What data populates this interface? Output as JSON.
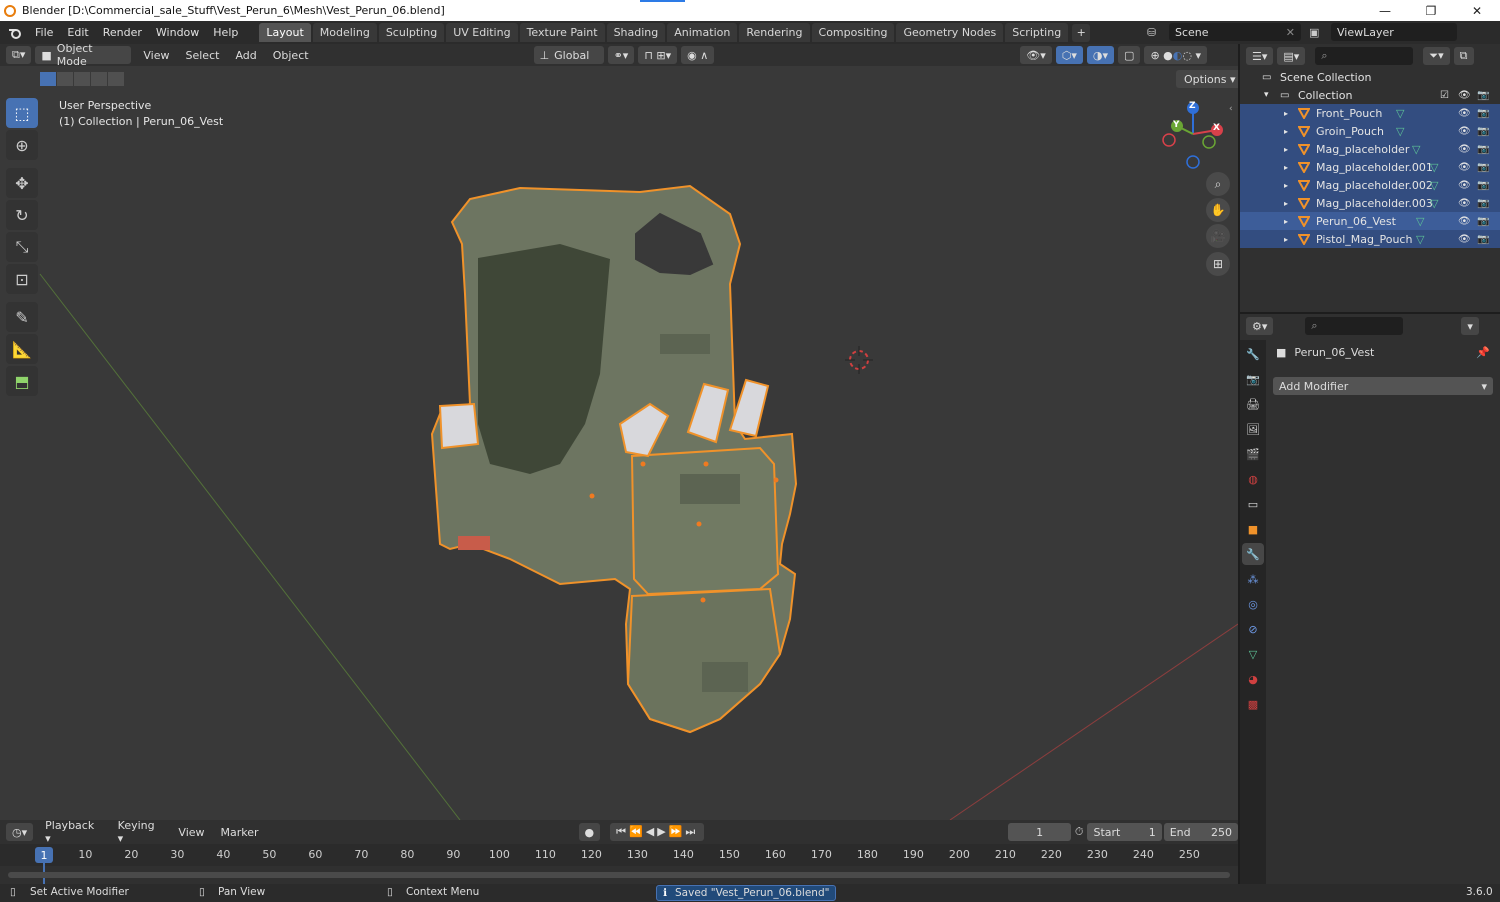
{
  "window": {
    "title": "Blender [D:\\Commercial_sale_Stuff\\Vest_Perun_6\\Mesh\\Vest_Perun_06.blend]",
    "minimize": "—",
    "restore": "❐",
    "close": "✕"
  },
  "topbar": {
    "menus": [
      "File",
      "Edit",
      "Render",
      "Window",
      "Help"
    ],
    "workspaces": [
      "Layout",
      "Modeling",
      "Sculpting",
      "UV Editing",
      "Texture Paint",
      "Shading",
      "Animation",
      "Rendering",
      "Compositing",
      "Geometry Nodes",
      "Scripting"
    ],
    "active_workspace": "Layout",
    "scene": "Scene",
    "view_layer": "ViewLayer"
  },
  "viewport": {
    "mode": "Object Mode",
    "menus": [
      "View",
      "Select",
      "Add",
      "Object"
    ],
    "transform_orientation": "Global",
    "info_line1": "User Perspective",
    "info_line2": "(1) Collection | Perun_06_Vest",
    "options": "Options",
    "gizmo_axes": {
      "z": "Z",
      "y": "Y",
      "x": "X"
    }
  },
  "outliner": {
    "root": "Scene Collection",
    "collection": "Collection",
    "items": [
      {
        "name": "Front_Pouch",
        "selected": true
      },
      {
        "name": "Groin_Pouch",
        "selected": true
      },
      {
        "name": "Mag_placeholder",
        "selected": true
      },
      {
        "name": "Mag_placeholder.001",
        "selected": true
      },
      {
        "name": "Mag_placeholder.002",
        "selected": true
      },
      {
        "name": "Mag_placeholder.003",
        "selected": true
      },
      {
        "name": "Perun_06_Vest",
        "selected": true,
        "active": true
      },
      {
        "name": "Pistol_Mag_Pouch",
        "selected": true
      }
    ]
  },
  "properties": {
    "object_name": "Perun_06_Vest",
    "add_modifier": "Add Modifier"
  },
  "timeline": {
    "menus": [
      "Playback",
      "Keying",
      "View",
      "Marker"
    ],
    "current_frame": "1",
    "start_label": "Start",
    "start": "1",
    "end_label": "End",
    "end": "250",
    "ruler_labels": [
      "1",
      "10",
      "20",
      "30",
      "40",
      "50",
      "60",
      "70",
      "80",
      "90",
      "100",
      "110",
      "120",
      "130",
      "140",
      "150",
      "160",
      "170",
      "180",
      "190",
      "200",
      "210",
      "220",
      "230",
      "240",
      "250"
    ],
    "ruler_frames": [
      1,
      10,
      20,
      30,
      40,
      50,
      60,
      70,
      80,
      90,
      100,
      110,
      120,
      130,
      140,
      150,
      160,
      170,
      180,
      190,
      200,
      210,
      220,
      230,
      240,
      250
    ]
  },
  "statusbar": {
    "left": "Set Active Modifier",
    "middle": "Pan View",
    "right": "Context Menu",
    "message": "Saved \"Vest_Perun_06.blend\"",
    "version": "3.6.0"
  },
  "colors": {
    "accent": "#4772b3",
    "selection_outline": "#f0922a",
    "vest": "#6d7561"
  }
}
